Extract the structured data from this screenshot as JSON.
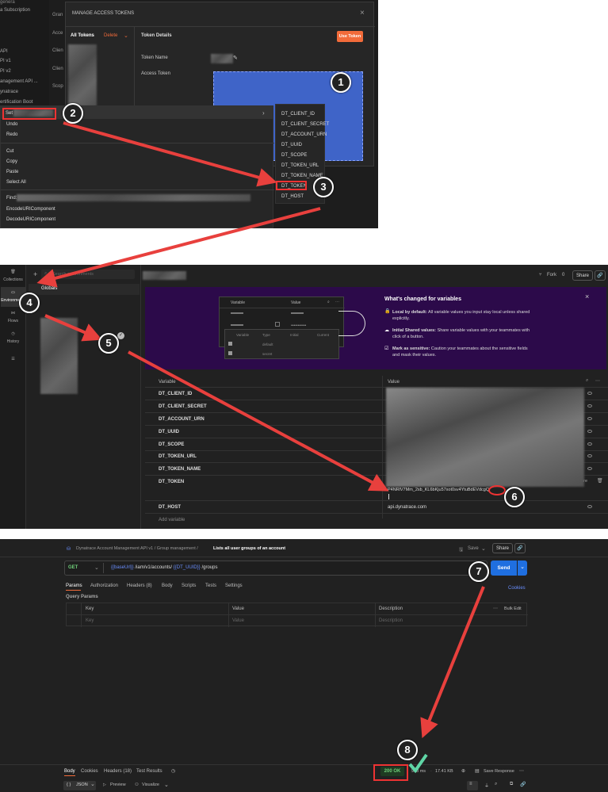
{
  "p1": {
    "left_nav": [
      "genera",
      "a Subscription",
      "API",
      "PI v1",
      "PI v2",
      "anagement API ...",
      "ynatrace",
      "ertification Boot"
    ],
    "col_labels": [
      "Gran",
      "Acce",
      "Clien",
      "Clien",
      "Scop",
      "Clien"
    ],
    "dialog_title": "MANAGE ACCESS TOKENS",
    "close": "×",
    "all_tokens": "All Tokens",
    "delete": "Delete",
    "token_details": "Token Details",
    "use_token": "Use Token",
    "token_name": "Token Name",
    "access_token": "Access Token",
    "ctx": {
      "set": "Set",
      "undo": "Undo",
      "redo": "Redo",
      "cut": "Cut",
      "copy": "Copy",
      "paste": "Paste",
      "select_all": "Select All",
      "find": "Find:",
      "encode": "EncodeURIComponent",
      "decode": "DecodeURIComponent"
    },
    "submenu": [
      "DT_CLIENT_ID",
      "DT_CLIENT_SECRET",
      "DT_ACCOUNT_URN",
      "DT_UUID",
      "DT_SCOPE",
      "DT_TOKEN_URL",
      "DT_TOKEN_NAME",
      "DT_TOKEN",
      "DT_HOST"
    ]
  },
  "p2": {
    "sidebar": [
      "Collections",
      "Environments",
      "Flows",
      "History"
    ],
    "search_placeholder": "Search environments",
    "globals": "Globals",
    "fork": "Fork",
    "fork_count": "0",
    "share": "Share",
    "promo": {
      "title": "What's changed for variables",
      "mini_headers": [
        "Variable",
        "Value"
      ],
      "mini_table_headers": [
        "Variable",
        "Type",
        "Initial",
        "Current"
      ],
      "mini_types": [
        "default",
        "secret"
      ],
      "b1_bold": "Local by default:",
      "b1": "All variable values you input stay local unless shared explicitly.",
      "b2_bold": "Initial Shared values:",
      "b2": "Share variable values with your teammates with click of a button.",
      "b3_bold": "Mark as sensitive:",
      "b3": "Caution your teammates about the sensitive fields and mask their values."
    },
    "hdr_variable": "Variable",
    "hdr_value": "Value",
    "vars": [
      "DT_CLIENT_ID",
      "DT_CLIENT_SECRET",
      "DT_ACCOUNT_URN",
      "DT_UUID",
      "DT_SCOPE",
      "DT_TOKEN_URL",
      "DT_TOKEN_NAME",
      "DT_TOKEN",
      "DT_HOST"
    ],
    "token_value": "P4NRlV7Mm_2sb_KL6bKju57xot0sv4YtuBdEVdcgQ",
    "host_value": "api.dynatrace.com",
    "share_label": "hare",
    "add_variable": "Add variable"
  },
  "p3": {
    "breadcrumb": "Dynatrace Account Management API v1 / Group management /",
    "request_title": "Lists all user groups of an account",
    "save": "Save",
    "share": "Share",
    "method": "GET",
    "url_1": "{{baseUrl}}",
    "url_2": "/iam/v1/accounts/",
    "url_3": "{{DT_UUID}}",
    "url_4": "/groups",
    "send": "Send",
    "tabs": [
      "Params",
      "Authorization",
      "Headers (8)",
      "Body",
      "Scripts",
      "Tests",
      "Settings"
    ],
    "cookies": "Cookies",
    "query_params": "Query Params",
    "cols": [
      "Key",
      "Value",
      "Description"
    ],
    "bulk_edit": "Bulk Edit",
    "ph_key": "Key",
    "ph_value": "Value",
    "ph_desc": "Description",
    "resp_tabs": [
      "Body",
      "Cookies",
      "Headers (18)",
      "Test Results"
    ],
    "status": "200 OK",
    "time": "908 ms",
    "size": "17.41 KB",
    "save_response": "Save Response",
    "format": "JSON",
    "preview": "Preview",
    "visualize": "Visualize"
  },
  "badges": [
    "1",
    "2",
    "3",
    "4",
    "5",
    "6",
    "7",
    "8"
  ],
  "colors": {
    "arrow": "#e8403d",
    "send": "#1f6fe0",
    "use_token": "#f26b3a",
    "promo": "#2c0a4a",
    "token_blue": "#3f64c8",
    "ok": "#6fcf7a"
  }
}
